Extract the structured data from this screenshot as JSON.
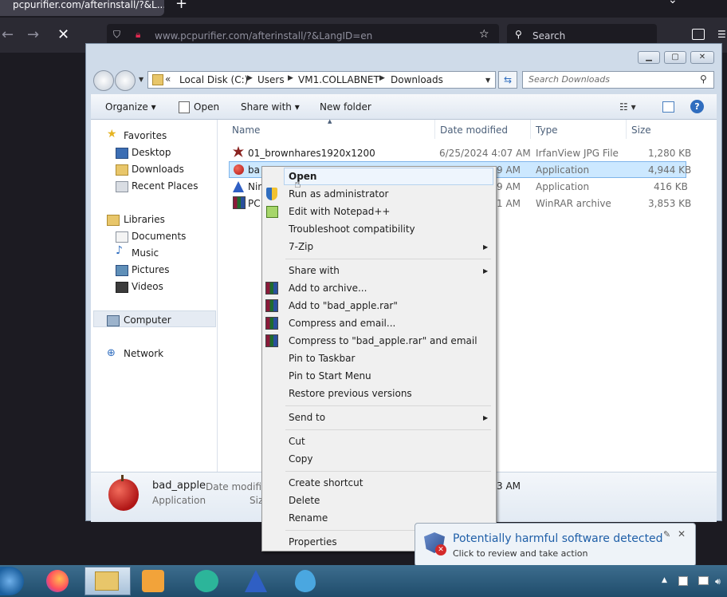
{
  "browser": {
    "tab_title": "pcpurifier.com/afterinstall/?&L...",
    "url": "www.pcpurifier.com/afterinstall/?&LangID=en",
    "search_placeholder": "Search"
  },
  "explorer": {
    "breadcrumb": [
      "Local Disk (C:)",
      "Users",
      "VM1.COLLABNET",
      "Downloads"
    ],
    "search_placeholder": "Search Downloads",
    "commands": {
      "organize": "Organize",
      "open": "Open",
      "share_with": "Share with",
      "new_folder": "New folder"
    },
    "nav": {
      "favorites": "Favorites",
      "desktop": "Desktop",
      "downloads": "Downloads",
      "recent_places": "Recent Places",
      "libraries": "Libraries",
      "documents": "Documents",
      "music": "Music",
      "pictures": "Pictures",
      "videos": "Videos",
      "computer": "Computer",
      "network": "Network"
    },
    "columns": {
      "name": "Name",
      "date_modified": "Date modified",
      "type": "Type",
      "size": "Size"
    },
    "files": [
      {
        "name": "01_brownhares1920x1200",
        "date": "6/25/2024 4:07 AM",
        "type": "IrfanView JPG File",
        "size": "1,280 KB"
      },
      {
        "name": "ba",
        "date": "9 AM",
        "type": "Application",
        "size": "4,944 KB"
      },
      {
        "name": "Nin",
        "date": "9 AM",
        "type": "Application",
        "size": "416 KB"
      },
      {
        "name": "PC",
        "date": "1 AM",
        "type": "WinRAR archive",
        "size": "3,853 KB"
      }
    ],
    "details": {
      "name": "bad_apple",
      "date_label": "Date modifie",
      "type": "Application",
      "size_label": "Siz",
      "date_tail": "3 AM"
    }
  },
  "context_menu": {
    "open": "Open",
    "run_as_admin": "Run as administrator",
    "edit_notepad": "Edit with Notepad++",
    "troubleshoot": "Troubleshoot compatibility",
    "seven_zip": "7-Zip",
    "share_with": "Share with",
    "add_archive": "Add to archive...",
    "add_rar": "Add to \"bad_apple.rar\"",
    "compress_email": "Compress and email...",
    "compress_rar_email": "Compress to \"bad_apple.rar\" and email",
    "pin_taskbar": "Pin to Taskbar",
    "pin_start": "Pin to Start Menu",
    "restore": "Restore previous versions",
    "send_to": "Send to",
    "cut": "Cut",
    "copy": "Copy",
    "create_shortcut": "Create shortcut",
    "delete": "Delete",
    "rename": "Rename",
    "properties": "Properties"
  },
  "notification": {
    "title": "Potentially harmful software detected",
    "subtitle": "Click to review and take action"
  }
}
